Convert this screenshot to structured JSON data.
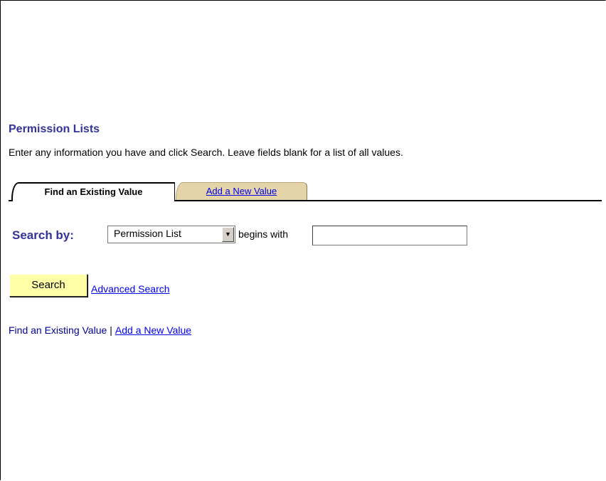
{
  "page": {
    "title": "Permission Lists",
    "instructions": "Enter any information you have and click Search. Leave fields blank for a list of all values."
  },
  "tabs": [
    {
      "label": "Find an Existing Value",
      "active": true
    },
    {
      "label": "Add a New Value",
      "active": false
    }
  ],
  "search_criteria": {
    "label": "Search by:",
    "field_selected": "Permission List",
    "operator": "begins with",
    "value": "",
    "placeholder": ""
  },
  "actions": {
    "search_button": "Search",
    "advanced_search_link": "Advanced Search"
  },
  "footer": {
    "current_label": "Find an Existing Value",
    "separator": "|",
    "add_link": "Add a New Value"
  },
  "icons": {
    "select_arrow": "dropdown-arrow-icon"
  },
  "colors": {
    "heading": "#333399",
    "link": "#0000ee",
    "inactive_tab": "#e4d4a8",
    "search_button": "#ffffa8"
  }
}
